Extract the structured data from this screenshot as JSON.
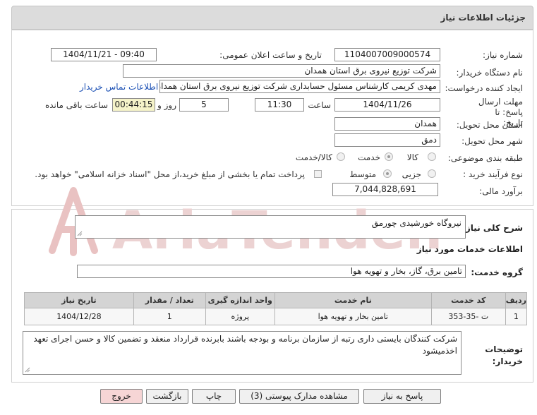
{
  "header": {
    "title": "جزئیات اطلاعات نیاز"
  },
  "form": {
    "need_number_label": "شماره نیاز:",
    "need_number": "1104007009000574",
    "announce_label": "تاریخ و ساعت اعلان عمومی:",
    "announce_value": "1404/11/21 - 09:40",
    "buyer_label": "نام دستگاه خریدار:",
    "buyer_value": "شرکت توزیع نیروی برق استان همدان",
    "creator_label": "ایجاد کننده درخواست:",
    "creator_value": "مهدی کریمی کارشناس مسئول حسابداری شرکت توزیع نیروی برق استان همدان",
    "contact_link": "اطلاعات تماس خریدار",
    "deadline_label": "مهلت ارسال پاسخ: تا تاریخ:",
    "deadline_date": "1404/11/26",
    "time_label": "ساعت",
    "deadline_time": "11:30",
    "days_value": "5",
    "days_label": "روز و",
    "remaining_value": "00:44:15",
    "remaining_label": "ساعت باقی مانده",
    "province_label": "استان محل تحویل:",
    "province_value": "همدان",
    "city_label": "شهر محل تحویل:",
    "city_value": "دمق",
    "category_label": "طبقه بندی موضوعی:",
    "category_options": [
      "کالا",
      "خدمت",
      "کالا/خدمت"
    ],
    "category_selected": "خدمت",
    "process_label": "نوع فرآیند خرید :",
    "process_options": [
      "جزیی",
      "متوسط"
    ],
    "process_selected": "متوسط",
    "payment_note": "پرداخت تمام یا بخشی از مبلغ خرید،از محل \"اسناد خزانه اسلامی\" خواهد بود.",
    "estimate_label": "برآورد مالی:",
    "estimate_value": "7,044,828,691"
  },
  "need": {
    "summary_label": "شرح کلی نیاز:",
    "summary_value": "نیروگاه خورشیدی چورمق",
    "services_title": "اطلاعات خدمات مورد نیاز",
    "group_label": "گروه خدمت:",
    "group_value": "تامین برق، گاز، بخار و تهویه هوا"
  },
  "table": {
    "headers": [
      "ردیف",
      "کد خدمت",
      "نام خدمت",
      "واحد اندازه گیری",
      "تعداد / مقدار",
      "تاریخ نیاز"
    ],
    "rows": [
      [
        "1",
        "ت -35-353",
        "تامین بخار و تهویه هوا",
        "پروژه",
        "1",
        "1404/12/28"
      ]
    ]
  },
  "buyer_notes": {
    "label": "توضیحات خریدار:",
    "value": "شرکت کنندگان بایستی داری رتبه از سازمان برنامه و بودجه باشند بابرنده قرارداد منعقد و تضمین کالا و حسن اجرای تعهد اخذمیشود"
  },
  "buttons": {
    "reply": "پاسخ به نیاز",
    "attachments": "مشاهده مدارک پیوستی (3)",
    "print": "چاپ",
    "back": "بازگشت",
    "exit": "خروج"
  },
  "watermark": {
    "brand": "AriaTender.neT"
  },
  "colors": {
    "link": "#1a4fb4",
    "header_bg": "#dcdcdc",
    "remaining_bg": "#f5f3c9",
    "exit_bg": "#f6d5d5",
    "watermark": "#e9c2c2"
  }
}
